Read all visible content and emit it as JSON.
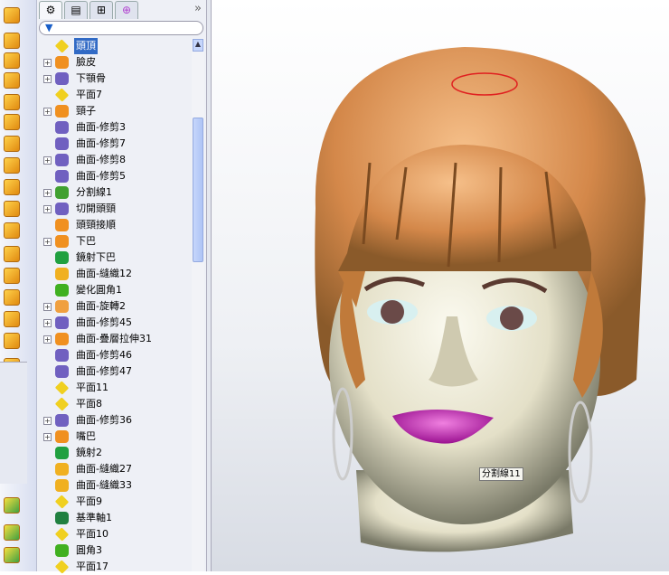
{
  "panel": {
    "tabs": [
      "feature-manager",
      "property-manager",
      "configuration-manager",
      "dimxpert-manager"
    ],
    "more": "»",
    "filter_icon": "filter-icon"
  },
  "tree": [
    {
      "label": "頭頂",
      "icon": "plane",
      "expand": false,
      "selected": true
    },
    {
      "label": "臉皮",
      "icon": "loft",
      "expand": true
    },
    {
      "label": "下顎骨",
      "icon": "trim",
      "expand": true
    },
    {
      "label": "平面7",
      "icon": "plane",
      "expand": false
    },
    {
      "label": "頸子",
      "icon": "loft",
      "expand": true
    },
    {
      "label": "曲面-修剪3",
      "icon": "trim",
      "expand": false
    },
    {
      "label": "曲面-修剪7",
      "icon": "trim",
      "expand": false
    },
    {
      "label": "曲面-修剪8",
      "icon": "trim",
      "expand": true
    },
    {
      "label": "曲面-修剪5",
      "icon": "trim",
      "expand": false
    },
    {
      "label": "分割線1",
      "icon": "split",
      "expand": true
    },
    {
      "label": "切開頭頸",
      "icon": "trim",
      "expand": true
    },
    {
      "label": "頭頸接順",
      "icon": "loft",
      "expand": false
    },
    {
      "label": "下巴",
      "icon": "loft",
      "expand": true
    },
    {
      "label": "鏡射下巴",
      "icon": "mirror",
      "expand": false
    },
    {
      "label": "曲面-縫織12",
      "icon": "knit",
      "expand": false
    },
    {
      "label": "變化圓角1",
      "icon": "fillet",
      "expand": false
    },
    {
      "label": "曲面-旋轉2",
      "icon": "revolve",
      "expand": true
    },
    {
      "label": "曲面-修剪45",
      "icon": "trim",
      "expand": true
    },
    {
      "label": "曲面-疊層拉伸31",
      "icon": "loft",
      "expand": true
    },
    {
      "label": "曲面-修剪46",
      "icon": "trim",
      "expand": false
    },
    {
      "label": "曲面-修剪47",
      "icon": "trim",
      "expand": false
    },
    {
      "label": "平面11",
      "icon": "plane",
      "expand": false
    },
    {
      "label": "平面8",
      "icon": "plane",
      "expand": false
    },
    {
      "label": "曲面-修剪36",
      "icon": "trim",
      "expand": true
    },
    {
      "label": "嘴巴",
      "icon": "loft",
      "expand": true
    },
    {
      "label": "鏡射2",
      "icon": "mirror",
      "expand": false
    },
    {
      "label": "曲面-縫織27",
      "icon": "knit",
      "expand": false
    },
    {
      "label": "曲面-縫織33",
      "icon": "knit",
      "expand": false
    },
    {
      "label": "平面9",
      "icon": "plane",
      "expand": false
    },
    {
      "label": "基準軸1",
      "icon": "axis",
      "expand": false
    },
    {
      "label": "平面10",
      "icon": "plane",
      "expand": false
    },
    {
      "label": "圓角3",
      "icon": "fillet",
      "expand": false
    },
    {
      "label": "平面17",
      "icon": "plane",
      "expand": false
    }
  ],
  "viewport": {
    "callout": "分割線11"
  },
  "colors": {
    "hair": "#d98a4a",
    "skin": "#e4e0c8",
    "lips": "#c020b0",
    "selection": "#316ac5"
  }
}
